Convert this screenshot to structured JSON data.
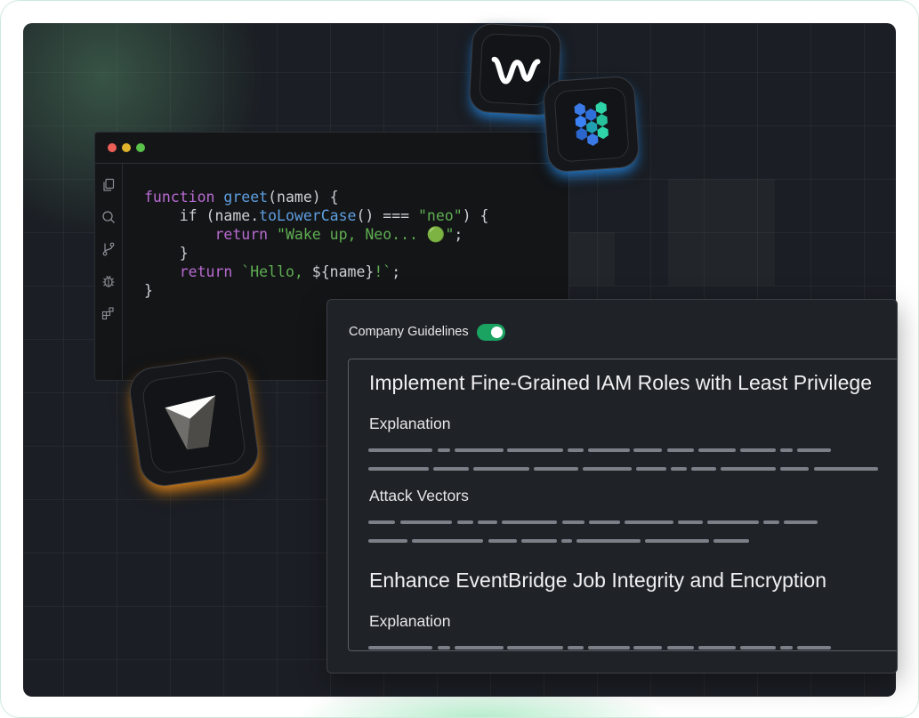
{
  "code_editor": {
    "lines": [
      [
        {
          "t": "function",
          "c": "kw"
        },
        {
          "t": " ",
          "c": "pl"
        },
        {
          "t": "greet",
          "c": "fn"
        },
        {
          "t": "(name) {",
          "c": "pl"
        }
      ],
      [
        {
          "t": "    ",
          "c": "pl"
        },
        {
          "t": "if",
          "c": "pl"
        },
        {
          "t": " (name.",
          "c": "pl"
        },
        {
          "t": "toLowerCase",
          "c": "fn"
        },
        {
          "t": "() === ",
          "c": "pl"
        },
        {
          "t": "\"neo\"",
          "c": "str"
        },
        {
          "t": ") {",
          "c": "pl"
        }
      ],
      [
        {
          "t": "        ",
          "c": "pl"
        },
        {
          "t": "return",
          "c": "kw"
        },
        {
          "t": " ",
          "c": "pl"
        },
        {
          "t": "\"Wake up, Neo... 🟢\"",
          "c": "str"
        },
        {
          "t": ";",
          "c": "pl"
        }
      ],
      [
        {
          "t": "    }",
          "c": "pl"
        }
      ],
      [
        {
          "t": "    ",
          "c": "pl"
        },
        {
          "t": "return",
          "c": "kw"
        },
        {
          "t": " ",
          "c": "pl"
        },
        {
          "t": "`Hello, ",
          "c": "str"
        },
        {
          "t": "${name}",
          "c": "pl"
        },
        {
          "t": "!`",
          "c": "str"
        },
        {
          "t": ";",
          "c": "pl"
        }
      ],
      [
        {
          "t": "}",
          "c": "pl"
        }
      ]
    ],
    "sidebar_icons": [
      "files-icon",
      "search-icon",
      "source-control-icon",
      "debug-icon",
      "extensions-icon"
    ]
  },
  "guidelines": {
    "toggle_label": "Company Guidelines",
    "toggle_on": true,
    "toggle_color": "#1aa361",
    "items": [
      {
        "title": "Implement Fine-Grained IAM Roles with Least Privilege",
        "sections": [
          "Explanation",
          "Attack Vectors"
        ]
      },
      {
        "title": "Enhance EventBridge Job Integrity and Encryption",
        "sections": [
          "Explanation"
        ]
      }
    ]
  },
  "app_icons": [
    "windsurf-logo-icon",
    "hexagon-cluster-logo-icon",
    "cursor-cube-logo-icon"
  ],
  "colors": {
    "accent_green": "#1aa361",
    "icon_glow_blue": "#2f9bff",
    "icon_glow_orange": "#ff9a1f"
  }
}
